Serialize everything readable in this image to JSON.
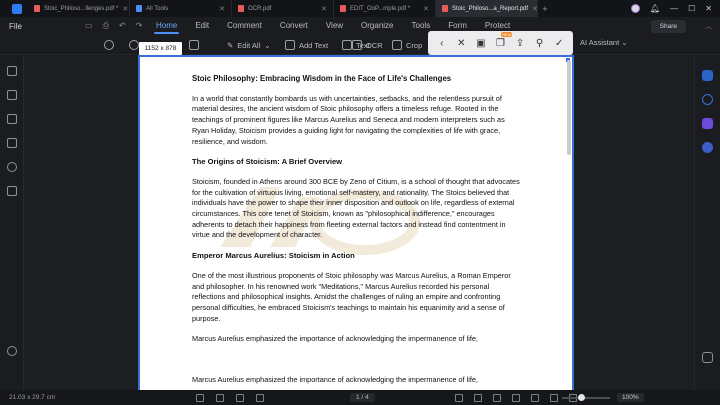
{
  "tabs": [
    {
      "label": "Stoic_Philoso...llenges.pdf *",
      "active": false
    },
    {
      "label": "All Tools",
      "active": false
    },
    {
      "label": "OCR.pdf",
      "active": false
    },
    {
      "label": "EDIT_OoP...mple.pdf *",
      "active": false
    },
    {
      "label": "Stoic_Philoso...a_Report.pdf",
      "active": true
    }
  ],
  "menu": {
    "file": "File",
    "items": [
      "Home",
      "Edit",
      "Comment",
      "Convert",
      "View",
      "Organize",
      "Tools",
      "Form",
      "Protect"
    ],
    "active": "Home",
    "share": "Share"
  },
  "toolbar": {
    "edit_all": "Edit All",
    "add_text": "Add Text",
    "text": "Text",
    "ocr": "OCR",
    "crop": "Crop",
    "ai_assistant": "AI Assistant"
  },
  "size_tip": "1152 x 878",
  "floatbar_badge": "NEW",
  "document": {
    "title": "Stoic Philosophy: Embracing Wisdom in the Face of Life's Challenges",
    "p1": "In a world that constantly bombards us with uncertainties, setbacks, and the relentless pursuit of material desires, the ancient wisdom of Stoic philosophy offers a timeless refuge. Rooted in the teachings of prominent figures like Marcus Aurelius and Seneca and modern interpreters such as Ryan Holiday, Stoicism provides a guiding light for navigating the complexities of life with grace, resilience, and wisdom.",
    "h2": "The Origins of Stoicism: A Brief Overview",
    "p2": "Stoicism, founded in Athens around 300 BCE by Zeno of Citium, is a school of thought that advocates for the cultivation of virtuous living, emotional self-mastery, and rationality. The Stoics believed that individuals have the power to shape their inner disposition and outlook on life, regardless of external circumstances. This core tenet of Stoicism, known as \"philosophical indifference,\" encourages adherents to detach their happiness from fleeting external factors and instead find contentment in virtue and the development of character.",
    "h3": "Emperor Marcus Aurelius: Stoicism in Action",
    "p3": "One of the most illustrious proponents of Stoic philosophy was Marcus Aurelius, a Roman Emperor and philosopher. In his renowned work \"Meditations,\" Marcus Aurelius recorded his personal reflections and philosophical insights. Amidst the challenges of ruling an empire and confronting personal difficulties, he embraced Stoicism's teachings to maintain his equanimity and a sense of purpose.",
    "p4": "Marcus Aurelius emphasized the importance of acknowledging the impermanence of life,",
    "bottom_line": "Marcus Aurelius emphasized the importance of acknowledging the impermanence of life,"
  },
  "status": {
    "dimensions": "21.03 x 29.7 cm",
    "page": "1 / 4",
    "zoom": "100%"
  },
  "colors": {
    "accent": "#4c8df6",
    "selection": "#3b6fd8",
    "badge": "#f08a2c"
  }
}
